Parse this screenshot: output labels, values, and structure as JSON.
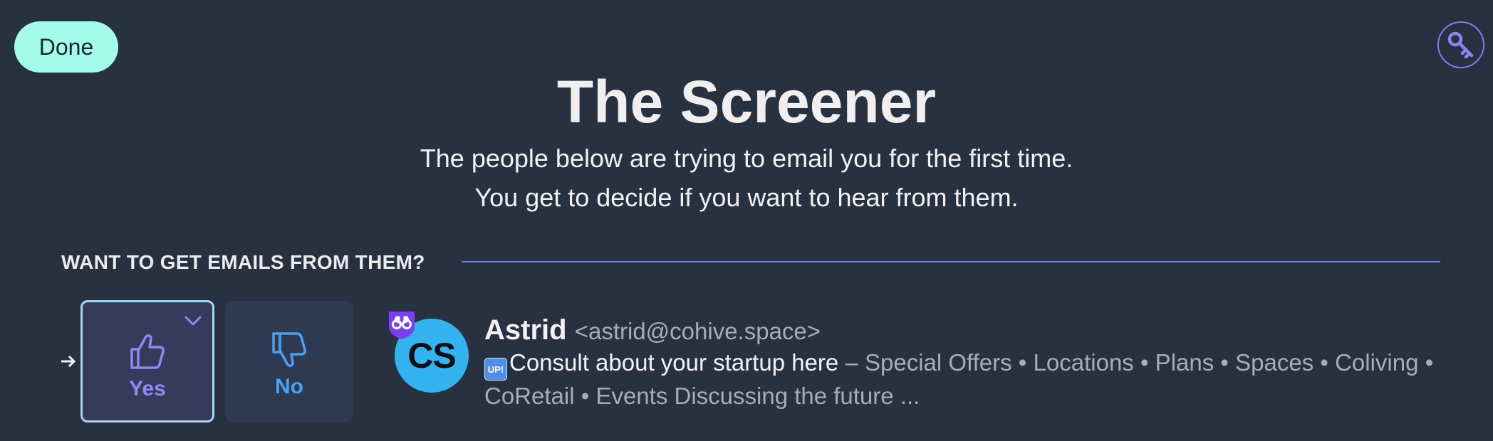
{
  "header": {
    "done_label": "Done",
    "key_icon": "key-icon"
  },
  "title": "The Screener",
  "subtitle": {
    "line1": "The people below are trying to email you for the first time.",
    "line2": "You get to decide if you want to hear from them."
  },
  "section": {
    "heading": "WANT TO GET EMAILS FROM THEM?"
  },
  "screener_item": {
    "yes_label": "Yes",
    "no_label": "No",
    "avatar_initials": "CS",
    "sender_name": "Astrid",
    "sender_email": "<astrid@cohive.space>",
    "subject_emoji": "UP!",
    "subject": "Consult about your startup here",
    "separator": " – ",
    "snippet": "Special Offers • Locations • Plans • Spaces • Coliving • CoRetail • Events Discussing the future ..."
  },
  "colors": {
    "background": "#283140",
    "done_button": "#a3fbe9",
    "accent_purple": "#8f88f5",
    "accent_blue": "#4ea0ef",
    "avatar": "#33b3ef",
    "rule": "#6a7fe8"
  }
}
